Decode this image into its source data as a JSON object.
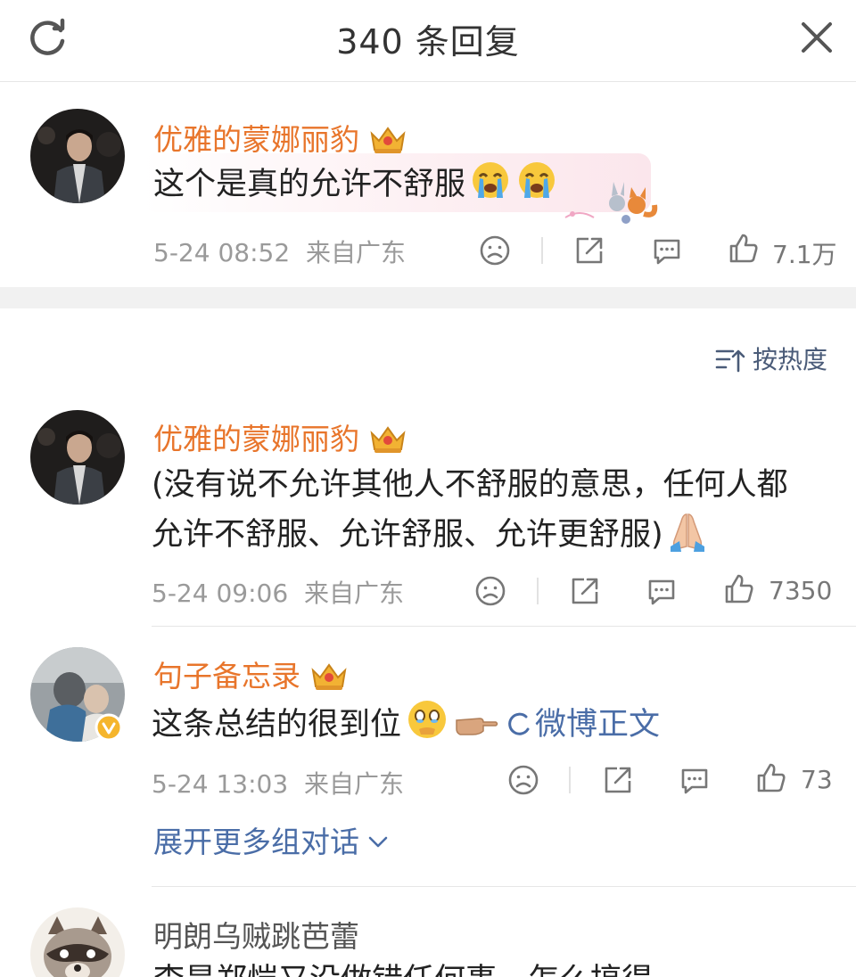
{
  "header": {
    "title": "340 条回复",
    "refresh_icon": "refresh-icon",
    "close_icon": "close-icon"
  },
  "comments": [
    {
      "username": "优雅的蒙娜丽豹",
      "text": "这个是真的允许不舒服",
      "emojis": [
        "crying-face",
        "crying-face"
      ],
      "time": "5-24 08:52",
      "location": "来自广东",
      "likes": "7.1万"
    },
    {
      "username": "优雅的蒙娜丽豹",
      "text_line1": "(没有说不允许其他人不舒服的意思，任何人都",
      "text_line2": "允许不舒服、允许舒服、允许更舒服)",
      "emojis": [
        "praying-hands"
      ],
      "time": "5-24 09:06",
      "location": "来自广东",
      "likes": "7350"
    },
    {
      "username": "句子备忘录",
      "text": "这条总结的很到位",
      "emojis": [
        "holding-back-tears-face",
        "pointing-right-hand"
      ],
      "link_text": "微博正文",
      "time": "5-24 13:03",
      "location": "来自广东",
      "likes": "73"
    },
    {
      "username": "明朗乌贼跳芭蕾",
      "partial_text": "李昊郑恺又没做错任何事，怎么搞得"
    }
  ],
  "sort": {
    "label": "按热度"
  },
  "expand": {
    "label": "展开更多组对话"
  },
  "colors": {
    "username": "#e8752b",
    "link": "#4a6da7",
    "meta": "#9a9a9a"
  }
}
